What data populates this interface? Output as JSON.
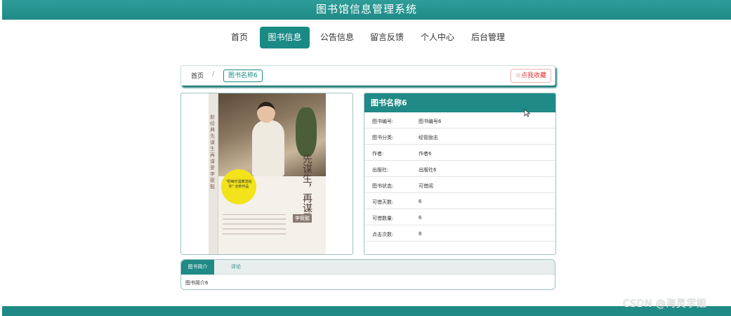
{
  "header": {
    "title": "图书馆信息管理系统"
  },
  "nav": {
    "items": [
      {
        "label": "首页"
      },
      {
        "label": "图书信息"
      },
      {
        "label": "公告信息"
      },
      {
        "label": "留言反馈"
      },
      {
        "label": "个人中心"
      },
      {
        "label": "后台管理"
      }
    ],
    "active_index": 1
  },
  "breadcrumb": {
    "home": "首页",
    "separator": "/",
    "current": "图书名称6"
  },
  "favorite_button": {
    "label": "☆点我收藏"
  },
  "cover": {
    "spine_text": "新经典 先谋生 再谋爱 李筱懿",
    "title": "先谋生，再谋爱",
    "author": "李筱懿",
    "sticker_text": "\"把每份温暖送给你\" 全新作品"
  },
  "book": {
    "title": "图书名称6",
    "fields": [
      {
        "label": "图书编号:",
        "value": "图书编号6"
      },
      {
        "label": "图书分类:",
        "value": "经管励志"
      },
      {
        "label": "作者:",
        "value": "作者6"
      },
      {
        "label": "出版社:",
        "value": "出版社6"
      },
      {
        "label": "图书状态:",
        "value": "可借阅"
      },
      {
        "label": "可借天数:",
        "value": "6"
      },
      {
        "label": "可借数量:",
        "value": "6"
      },
      {
        "label": "点击次数:",
        "value": "8"
      }
    ]
  },
  "tabs": {
    "items": [
      {
        "label": "图书简介"
      },
      {
        "label": "评论"
      }
    ],
    "content": "图书简介6"
  },
  "watermark": "CSDN @海灵学姐",
  "colors": {
    "primary": "#1f8a86",
    "accent_red": "#dd3333"
  }
}
